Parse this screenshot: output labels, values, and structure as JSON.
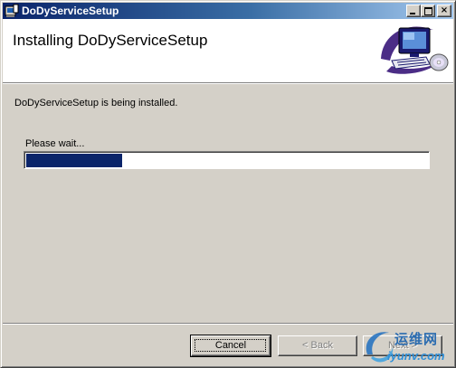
{
  "window": {
    "title": "DoDyServiceSetup",
    "controls": {
      "minimize": "_",
      "maximize": "□",
      "close": "×"
    }
  },
  "banner": {
    "title": "Installing DoDyServiceSetup",
    "graphic": "computer-with-cd-icon"
  },
  "main": {
    "status": "DoDyServiceSetup is being installed.",
    "wait_label": "Please wait...",
    "progress_fraction": 0.24
  },
  "buttons": {
    "cancel": "Cancel",
    "back": "< Back",
    "next": "Next >"
  },
  "watermark": {
    "cn": "运维网",
    "en": "iyunv.com"
  },
  "colors": {
    "titlebar_start": "#0a246a",
    "titlebar_end": "#a6caf0",
    "progress_fill": "#0a246a",
    "window_face": "#d4d0c8"
  }
}
